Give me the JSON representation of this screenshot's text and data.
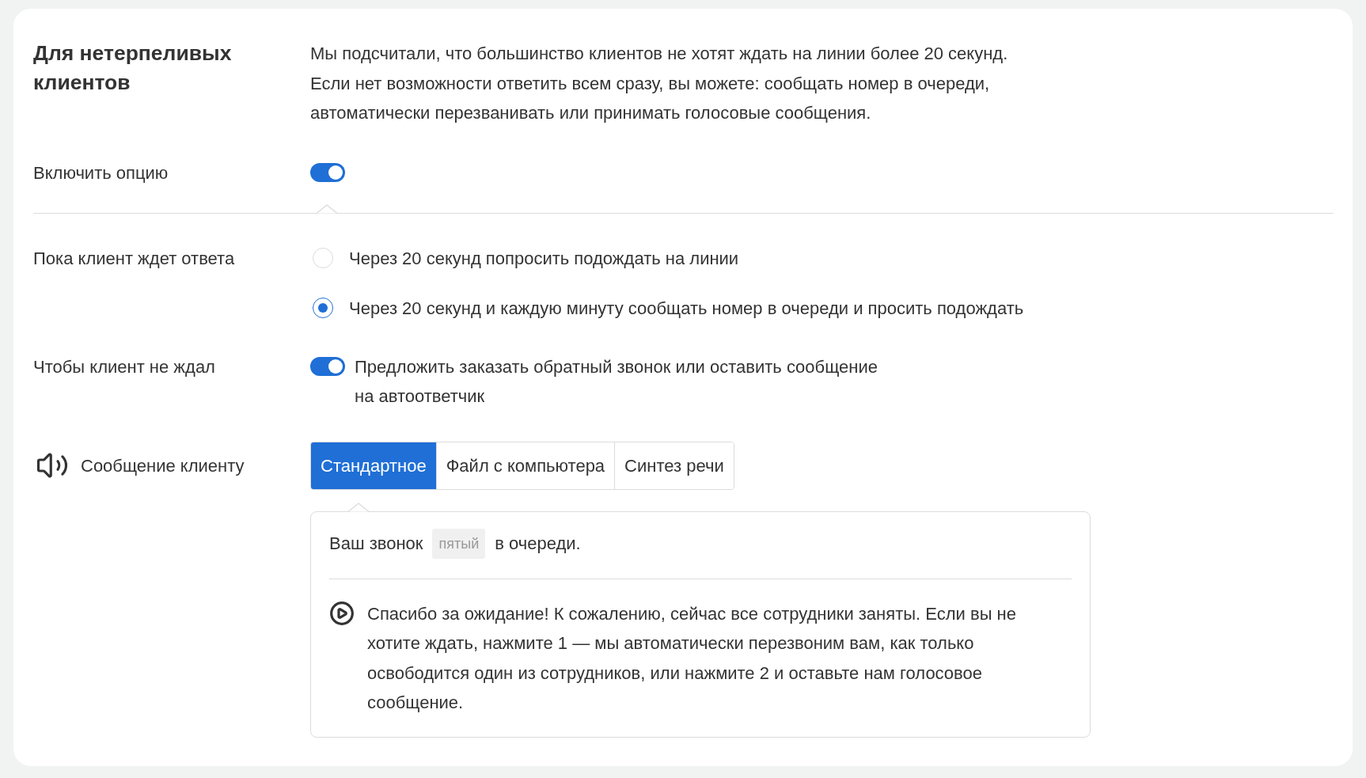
{
  "section": {
    "title": "Для нетерпеливых клиентов",
    "description": "Мы подсчитали, что большинство клиентов не хотят ждать на линии более 20 секунд. Если нет возможности ответить всем сразу, вы можете: сообщать номер в очереди, автоматически перезванивать или принимать голосовые сообщения."
  },
  "enable_option": {
    "label": "Включить опцию",
    "on": true
  },
  "waiting": {
    "label": "Пока клиент ждет ответа",
    "options": [
      {
        "label": "Через 20 секунд попросить подождать на линии",
        "selected": false
      },
      {
        "label": "Через 20 секунд и каждую минуту сообщать номер в очереди и просить подождать",
        "selected": true
      }
    ]
  },
  "no_wait": {
    "label": "Чтобы клиент не ждал",
    "toggle": {
      "label": "Предложить заказать обратный звонок или оставить сообщение на автоответчик",
      "on": true
    }
  },
  "message": {
    "label": "Сообщение клиенту",
    "tabs": [
      {
        "label": "Стандартное",
        "selected": true
      },
      {
        "label": "Файл с компьютера",
        "selected": false
      },
      {
        "label": "Синтез речи",
        "selected": false
      }
    ],
    "queue_text": {
      "before": "Ваш звонок",
      "token": "пятый",
      "after": "в очереди."
    },
    "playback_text": "Спасибо за ожидание! К сожалению, сейчас все сотрудники заняты. Если вы не хотите ждать, нажмите 1 — мы автоматически перезвоним вам, как только освободится один из сотрудников, или нажмите 2 и оставьте нам голосовое сообщение."
  }
}
